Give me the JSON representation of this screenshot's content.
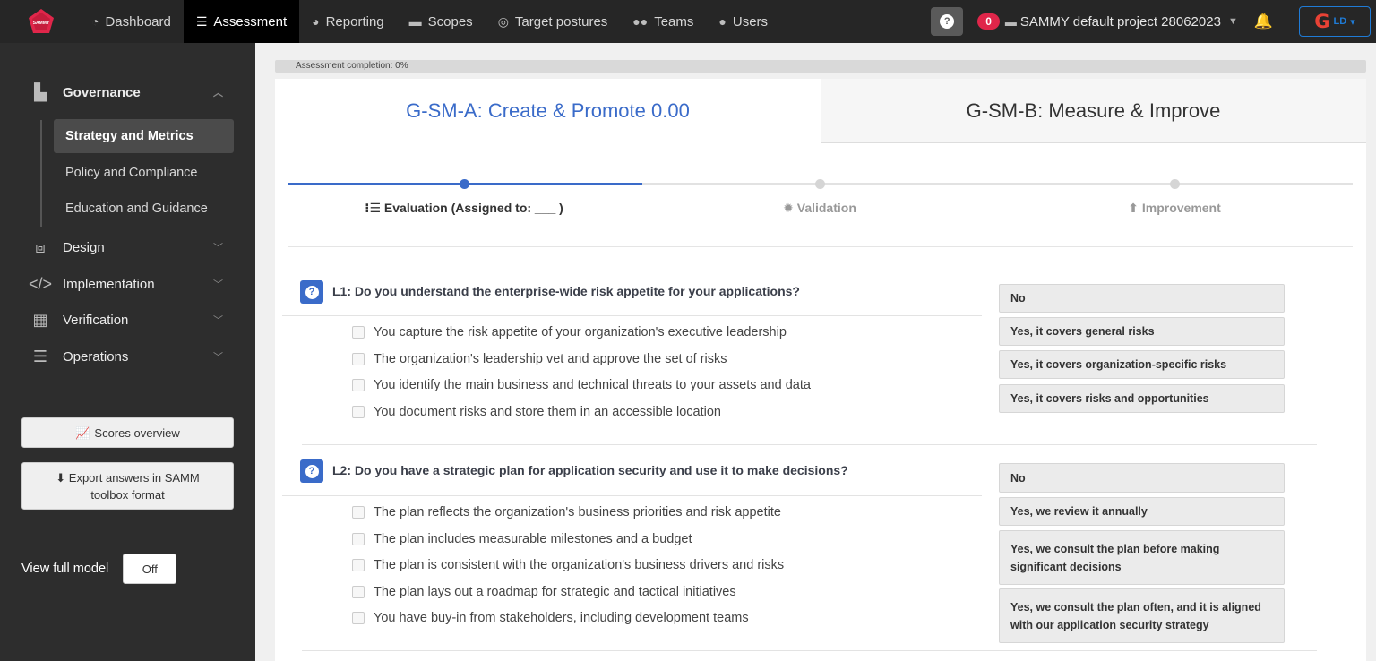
{
  "brand": {
    "logo_text": "SAMMY",
    "logo_color": "#e0264a"
  },
  "nav": {
    "items": [
      {
        "label": "Dashboard",
        "icon": "dashboard-gauge-icon"
      },
      {
        "label": "Assessment",
        "icon": "list-check-icon",
        "active": true
      },
      {
        "label": "Reporting",
        "icon": "pie-chart-icon"
      },
      {
        "label": "Scopes",
        "icon": "briefcase-icon"
      },
      {
        "label": "Target postures",
        "icon": "bullseye-icon"
      },
      {
        "label": "Teams",
        "icon": "users-group-icon"
      },
      {
        "label": "Users",
        "icon": "user-icon"
      }
    ]
  },
  "header": {
    "help_icon": "question-icon",
    "notification_count": "0",
    "project_name": "SAMMY default project 28062023",
    "bell_icon": "bell-icon",
    "user_initials": "LD",
    "google_letter": "G"
  },
  "sidebar": {
    "sections": [
      {
        "label": "Governance",
        "icon": "governance-icon",
        "expanded": true
      },
      {
        "label": "Design",
        "icon": "design-icon"
      },
      {
        "label": "Implementation",
        "icon": "code-icon"
      },
      {
        "label": "Verification",
        "icon": "chip-icon"
      },
      {
        "label": "Operations",
        "icon": "server-icon"
      }
    ],
    "sub_items": [
      {
        "label": "Strategy and Metrics",
        "active": true
      },
      {
        "label": "Policy and Compliance"
      },
      {
        "label": "Education and Guidance"
      }
    ],
    "scores_button": "Scores overview",
    "export_button": "Export answers in SAMM toolbox format",
    "view_full_model_label": "View full model",
    "view_full_model_value": "Off"
  },
  "main": {
    "completion_text": "Assessment completion: 0%",
    "completion_value": 0,
    "tabs": [
      {
        "label": "G-SM-A: Create & Promote 0.00",
        "active": true
      },
      {
        "label": "G-SM-B: Measure & Improve",
        "active": false
      }
    ],
    "steps": [
      {
        "label": "Evaluation (Assigned to: ___ )",
        "icon": "list-ol-icon",
        "active": true
      },
      {
        "label": "Validation",
        "icon": "cog-icon"
      },
      {
        "label": "Improvement",
        "icon": "arrow-circle-up-icon"
      }
    ],
    "questions": [
      {
        "title": "L1: Do you understand the enterprise-wide risk appetite for your applications?",
        "criteria": [
          "You capture the risk appetite of your organization's executive leadership",
          "The organization's leadership vet and approve the set of risks",
          "You identify the main business and technical threats to your assets and data",
          "You document risks and store them in an accessible location"
        ],
        "answers": [
          "No",
          "Yes, it covers general risks",
          "Yes, it covers organization-specific risks",
          "Yes, it covers risks and opportunities"
        ]
      },
      {
        "title": "L2: Do you have a strategic plan for application security and use it to make decisions?",
        "criteria": [
          "The plan reflects the organization's business priorities and risk appetite",
          "The plan includes measurable milestones and a budget",
          "The plan is consistent with the organization's business drivers and risks",
          "The plan lays out a roadmap for strategic and tactical initiatives",
          "You have buy-in from stakeholders, including development teams"
        ],
        "answers": [
          "No",
          "Yes, we review it annually",
          "Yes, we consult the plan before making significant decisions",
          "Yes, we consult the plan often, and it is aligned with our application security strategy"
        ]
      }
    ]
  },
  "colors": {
    "accent": "#3a6bc9",
    "badge": "#e0264a",
    "topbar": "#262626",
    "sidebar": "#2d2d2d"
  }
}
